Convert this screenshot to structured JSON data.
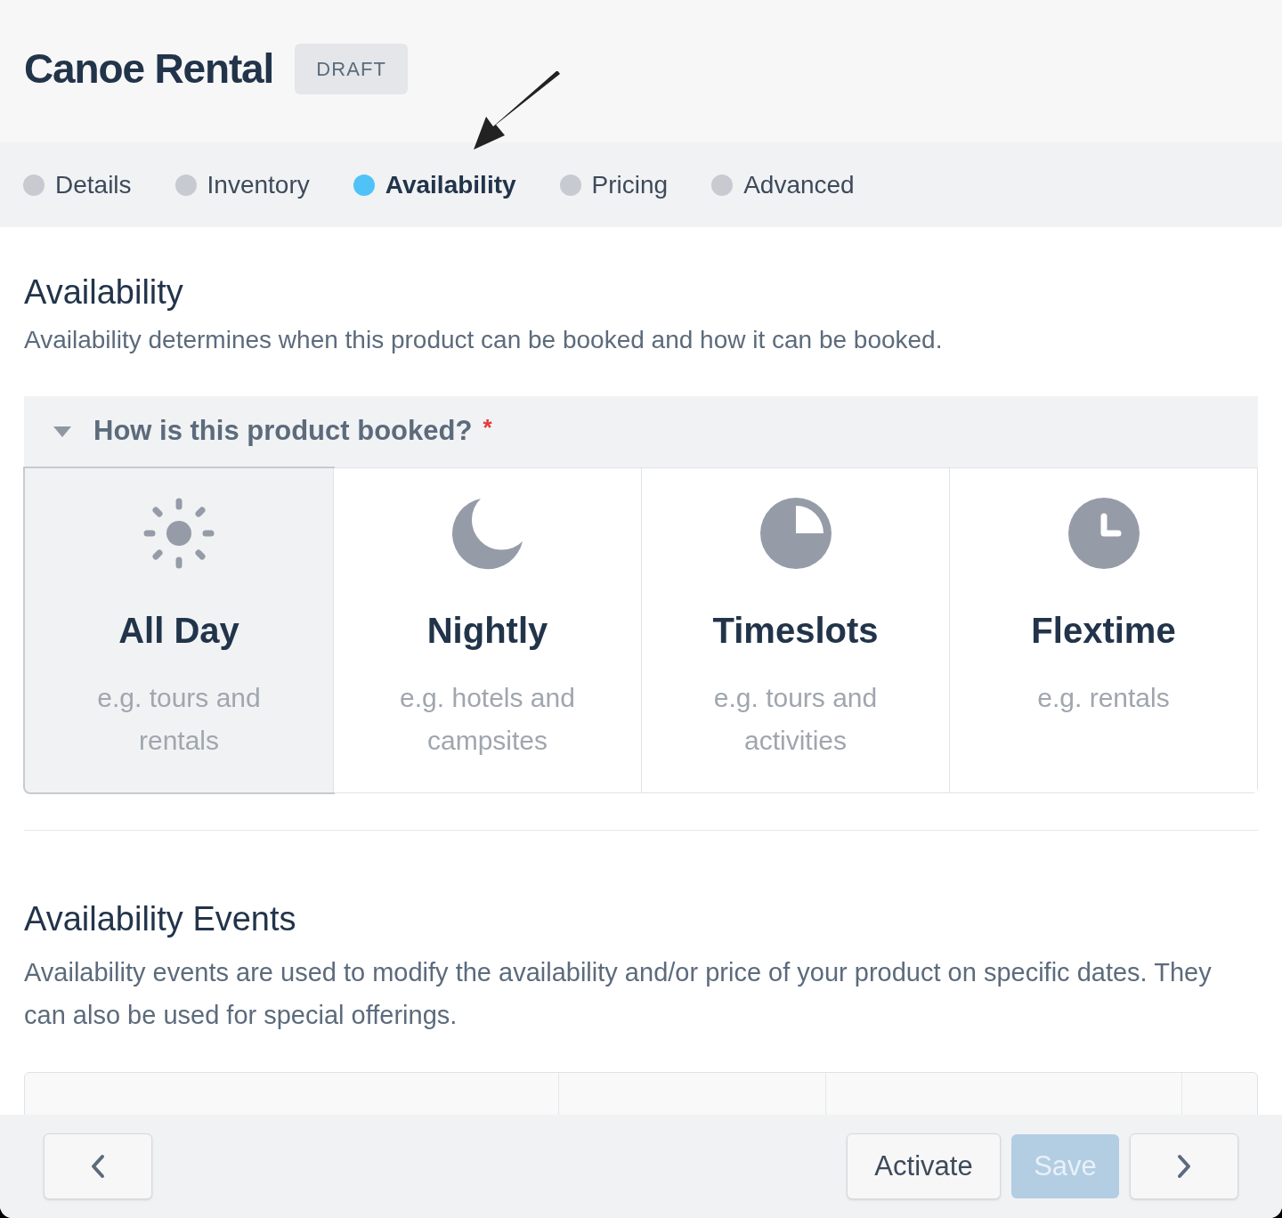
{
  "title": "Canoe Rental",
  "status_badge": "DRAFT",
  "steps": [
    {
      "label": "Details",
      "selected": false
    },
    {
      "label": "Inventory",
      "selected": false
    },
    {
      "label": "Availability",
      "selected": true
    },
    {
      "label": "Pricing",
      "selected": false
    },
    {
      "label": "Advanced",
      "selected": false
    }
  ],
  "availability": {
    "heading": "Availability",
    "description": "Availability determines when this product can be booked and how it can be booked.",
    "question": {
      "label": "How is this product booked?",
      "required_mark": "*",
      "expanded": true
    },
    "options": [
      {
        "kind": "allday",
        "title": "All Day",
        "example": "e.g. tours and rentals",
        "selected": true
      },
      {
        "kind": "nightly",
        "title": "Nightly",
        "example": "e.g. hotels and campsites",
        "selected": false
      },
      {
        "kind": "timeslots",
        "title": "Timeslots",
        "example": "e.g. tours and activities",
        "selected": false
      },
      {
        "kind": "flextime",
        "title": "Flextime",
        "example": "e.g. rentals",
        "selected": false
      }
    ]
  },
  "events": {
    "heading": "Availability Events",
    "description": "Availability events are used to modify the availability and/or price of your product on specific dates. They can also be used for special offerings."
  },
  "footer": {
    "activate": "Activate",
    "save": {
      "label": "Save",
      "disabled": true
    }
  }
}
